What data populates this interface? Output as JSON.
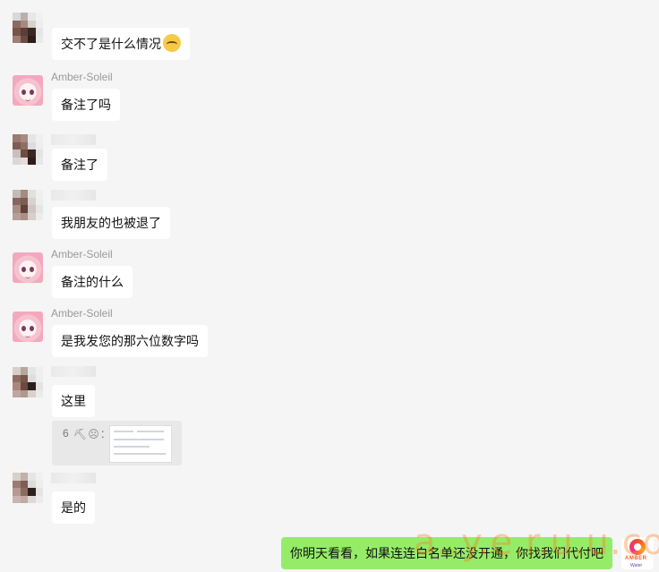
{
  "messages": [
    {
      "sender": "",
      "text": "交不了是什么情况",
      "has_emoji": true,
      "emoji": "crying-laughing-emoji"
    },
    {
      "sender": "Amber-Soleil",
      "text": "备注了吗"
    },
    {
      "sender": "",
      "text": "备注了"
    },
    {
      "sender": "",
      "text": "我朋友的也被退了"
    },
    {
      "sender": "Amber-Soleil",
      "text": "备注的什么"
    },
    {
      "sender": "Amber-Soleil",
      "text": "是我发您的那六位数字吗"
    },
    {
      "sender": "",
      "text": "这里"
    },
    {
      "sender": "",
      "text": "是的"
    }
  ],
  "quote": {
    "prefix": "6",
    "suffix": "："
  },
  "my_message": {
    "text": "你明天看看，如果连连白名单还没开通，你找我们代付吧"
  },
  "watermark": {
    "text": "a..y.e.r.u.u.com"
  },
  "logo": {
    "line1": "AMBER",
    "line2": "Water"
  },
  "colors": {
    "background": "#f5f5f5",
    "bubble_other": "#ffffff",
    "bubble_mine": "#95ec69"
  }
}
